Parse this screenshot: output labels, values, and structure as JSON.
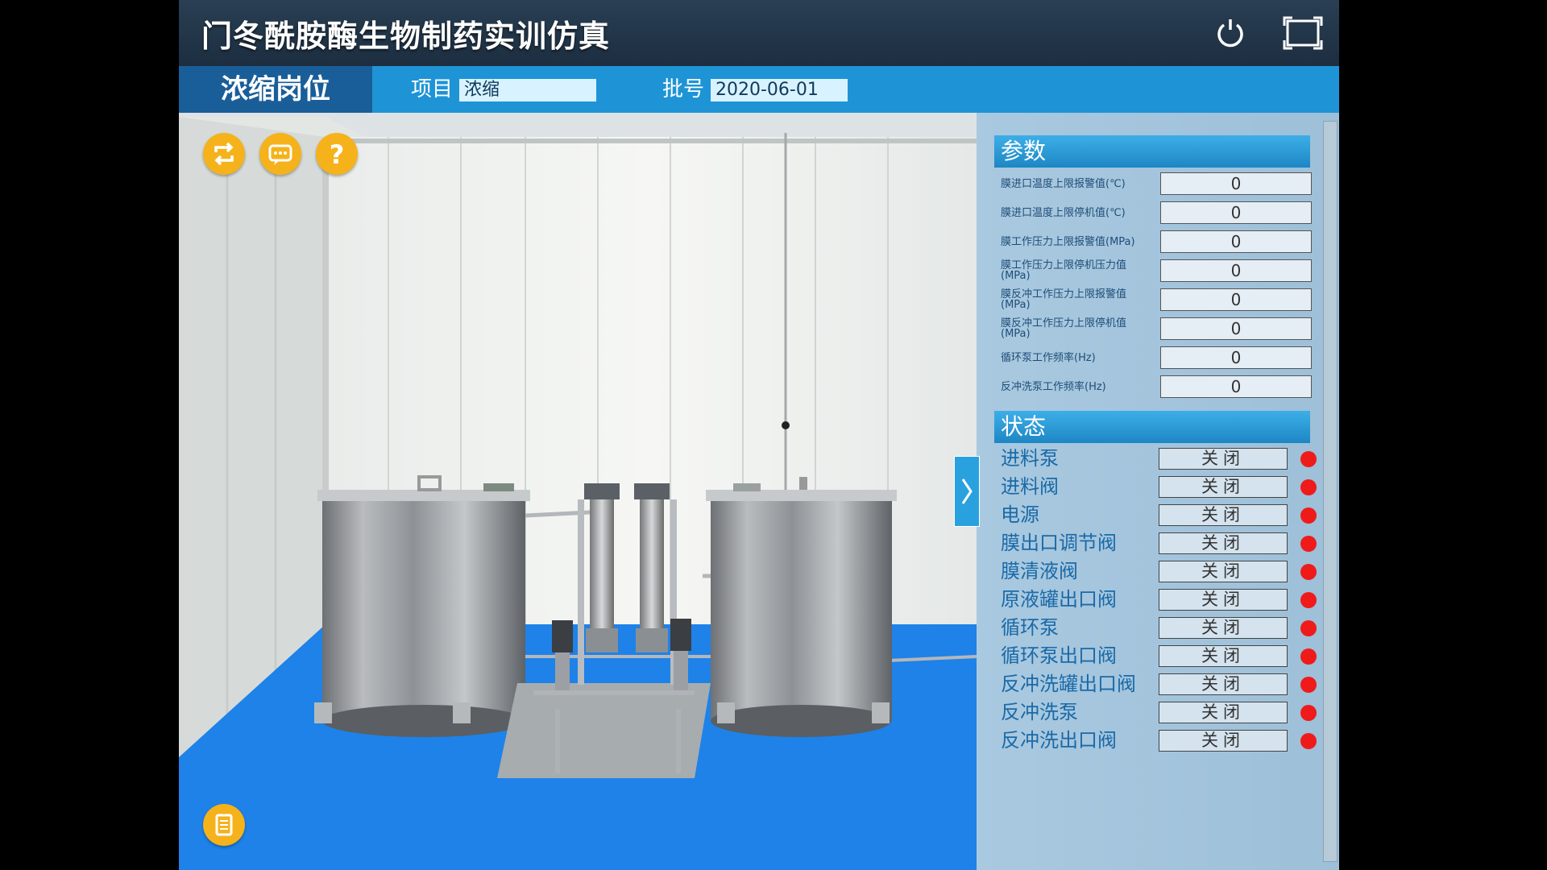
{
  "app": {
    "title": "门冬酰胺酶生物制药实训仿真"
  },
  "header": {
    "station": "浓缩岗位",
    "project_label": "项目",
    "project_value": "浓缩",
    "batch_label": "批号",
    "batch_value": "2020-06-01"
  },
  "icons": {
    "power": "power-icon",
    "fullscreen": "fullscreen-icon",
    "swap": "swap-icon",
    "chat": "chat-icon",
    "help": "help-icon",
    "document": "document-icon",
    "toggle": "chevron-right-icon"
  },
  "params": {
    "title": "参数",
    "items": [
      {
        "label": "膜进口温度上限报警值(℃)",
        "value": "0"
      },
      {
        "label": "膜进口温度上限停机值(℃)",
        "value": "0"
      },
      {
        "label": "膜工作压力上限报警值(MPa)",
        "value": "0"
      },
      {
        "label": "膜工作压力上限停机压力值(MPa)",
        "value": "0"
      },
      {
        "label": "膜反冲工作压力上限报警值(MPa)",
        "value": "0"
      },
      {
        "label": "膜反冲工作压力上限停机值(MPa)",
        "value": "0"
      },
      {
        "label": "循环泵工作频率(Hz)",
        "value": "0"
      },
      {
        "label": "反冲洗泵工作频率(Hz)",
        "value": "0"
      }
    ]
  },
  "status": {
    "title": "状态",
    "items": [
      {
        "label": "进料泵",
        "value": "关闭"
      },
      {
        "label": "进料阀",
        "value": "关闭"
      },
      {
        "label": "电源",
        "value": "关闭"
      },
      {
        "label": "膜出口调节阀",
        "value": "关闭"
      },
      {
        "label": "膜清液阀",
        "value": "关闭"
      },
      {
        "label": "原液罐出口阀",
        "value": "关闭"
      },
      {
        "label": "循环泵",
        "value": "关闭"
      },
      {
        "label": "循环泵出口阀",
        "value": "关闭"
      },
      {
        "label": "反冲洗罐出口阀",
        "value": "关闭"
      },
      {
        "label": "反冲洗泵",
        "value": "关闭"
      },
      {
        "label": "反冲洗出口阀",
        "value": "关闭"
      }
    ],
    "indicator_color": "#ef1b1b"
  },
  "colors": {
    "accent": "#1e94d6",
    "button": "#f5b21b",
    "floor": "#1e82e8"
  }
}
